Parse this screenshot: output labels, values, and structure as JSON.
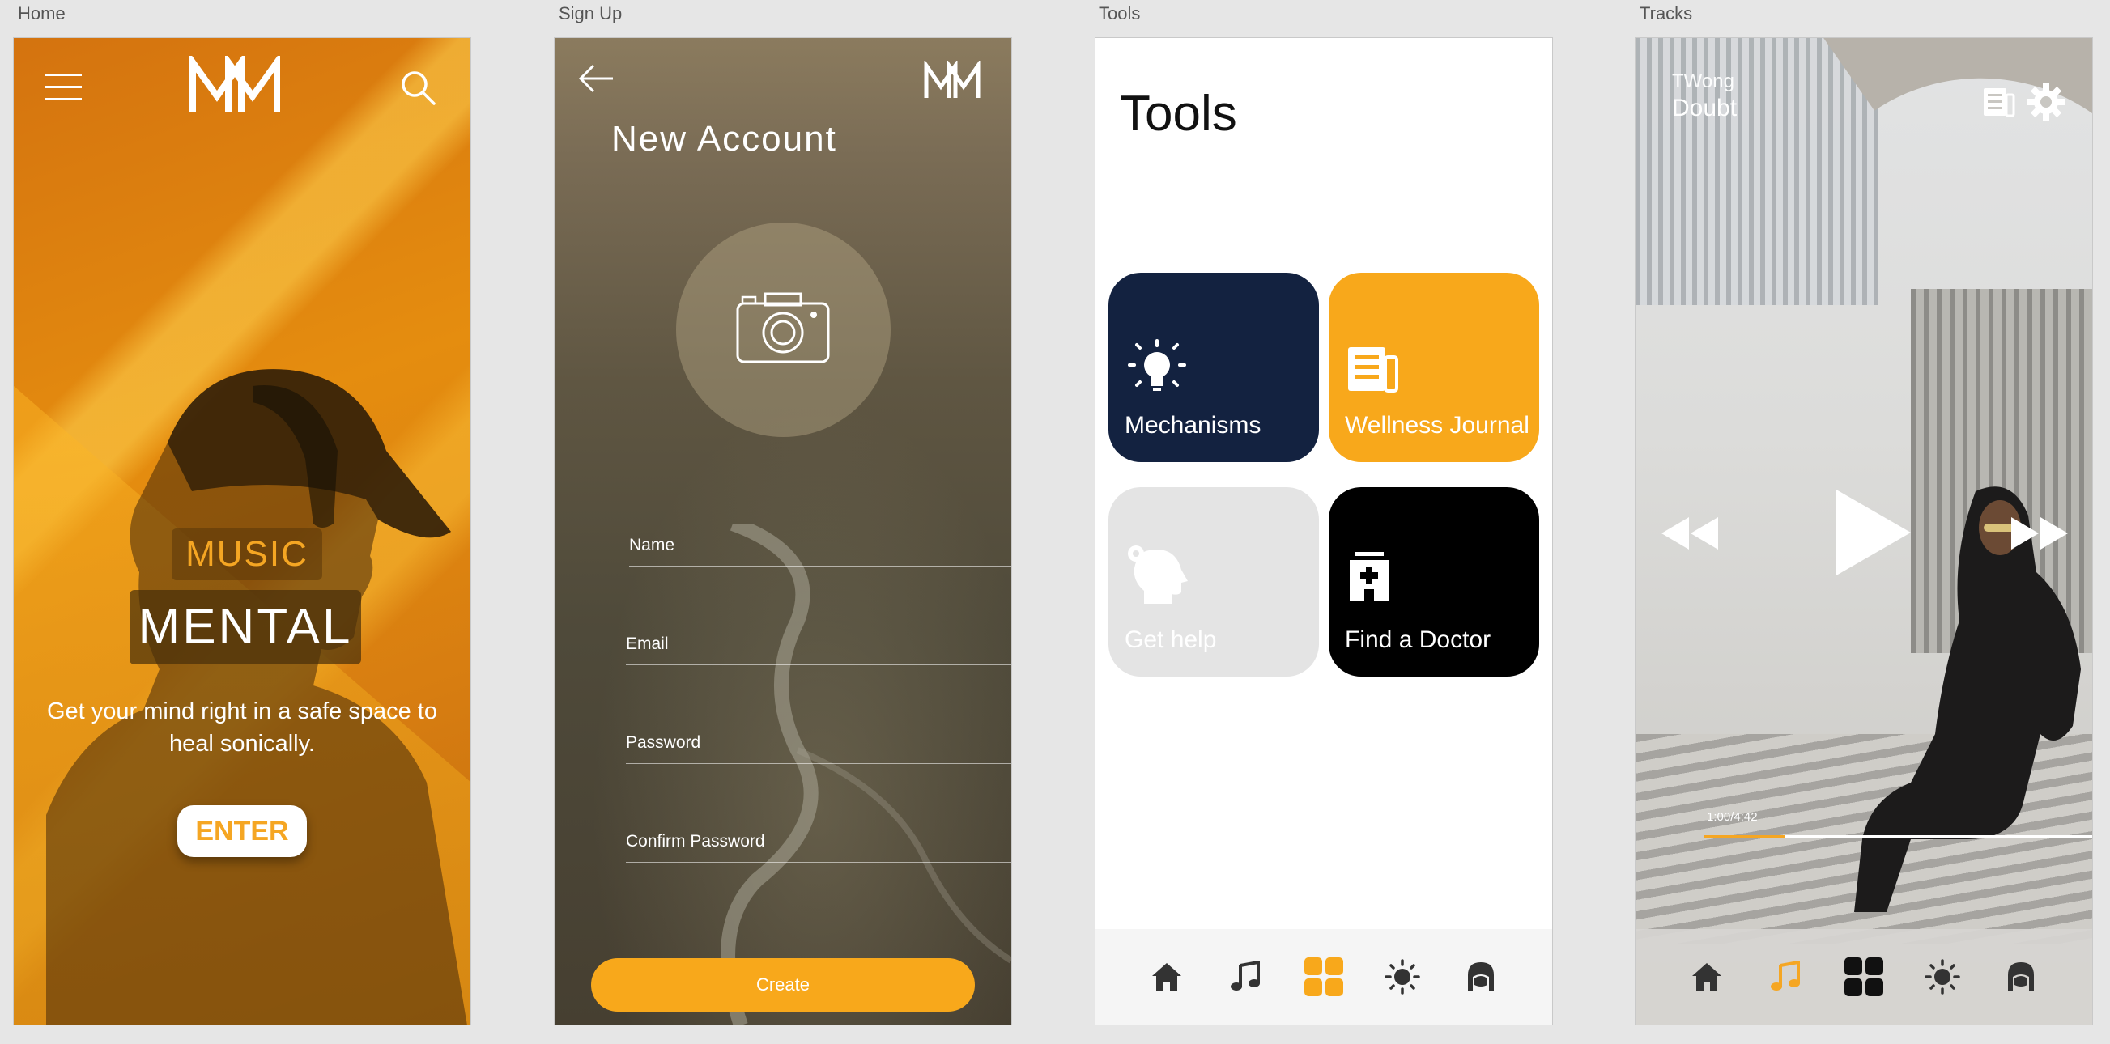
{
  "frames": {
    "home": "Home",
    "signup": "Sign Up",
    "tools": "Tools",
    "tracks": "Tracks"
  },
  "brand": {
    "logo": "MM",
    "accent": "#f5a623"
  },
  "home": {
    "music_label": "MUSIC",
    "mental_label": "MENTAL",
    "tagline": "Get your mind right in a safe space to heal sonically.",
    "enter_label": "ENTER",
    "icons": [
      "menu-icon",
      "search-icon"
    ]
  },
  "signup": {
    "title": "New Account",
    "fields": {
      "name": "Name",
      "email": "Email",
      "password": "Password",
      "confirm_password": "Confirm Password"
    },
    "create_label": "Create",
    "icons": [
      "back-arrow-icon",
      "camera-icon"
    ]
  },
  "tools": {
    "title": "Tools",
    "tiles": [
      {
        "label": "Mechanisms",
        "color": "#132240",
        "icon": "lightbulb-icon"
      },
      {
        "label": "Wellness Journal",
        "color": "#f8a81b",
        "icon": "journal-icon"
      },
      {
        "label": "Get help",
        "color": "#e4e4e4",
        "icon": "head-gear-icon"
      },
      {
        "label": "Find a Doctor",
        "color": "#000000",
        "icon": "hospital-icon"
      }
    ],
    "nav": [
      "home-icon",
      "music-note-icon",
      "grid-icon",
      "sun-icon",
      "profile-icon"
    ],
    "active_nav": "grid-icon"
  },
  "tracks": {
    "artist": "TWong",
    "track": "Doubt",
    "time": "1:00/4:42",
    "progress": 0.208,
    "icons": [
      "journal-icon",
      "gear-icon",
      "rewind-icon",
      "play-icon",
      "fast-forward-icon"
    ],
    "nav": [
      "home-icon",
      "music-note-icon",
      "grid-icon",
      "sun-icon",
      "profile-icon"
    ],
    "active_nav": "music-note-icon"
  }
}
